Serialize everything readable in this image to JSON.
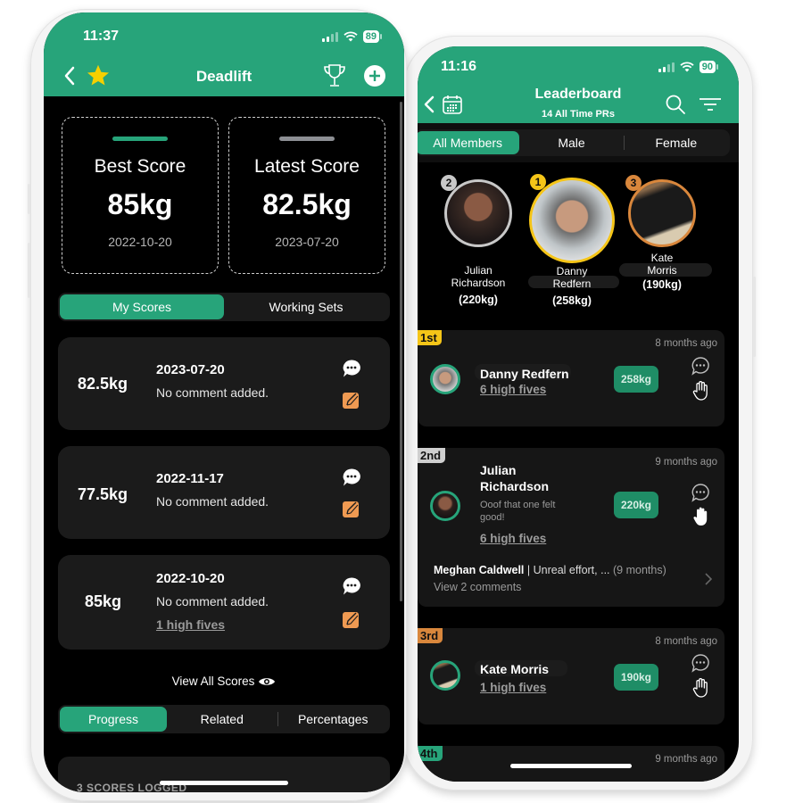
{
  "colors": {
    "brand_green": "#27a47a",
    "kg_badge_green": "#1f8d66",
    "edit_orange": "#ef9a52",
    "gold": "#f5c518",
    "silver": "#c8c8c8",
    "bronze": "#d9873c",
    "card_bg": "#1b1b1b"
  },
  "left_phone": {
    "status": {
      "time": "11:37",
      "battery": "89"
    },
    "header": {
      "title": "Deadlift",
      "icons": [
        "chevron-left-icon",
        "star-icon",
        "trophy-icon",
        "plus-circle-icon"
      ]
    },
    "best_score": {
      "label": "Best Score",
      "value": "85kg",
      "date": "2022-10-20"
    },
    "latest_score": {
      "label": "Latest Score",
      "value": "82.5kg",
      "date": "2023-07-20"
    },
    "score_tabs": [
      {
        "label": "My Scores",
        "active": true
      },
      {
        "label": "Working Sets",
        "active": false
      }
    ],
    "scores": [
      {
        "weight": "82.5kg",
        "date": "2023-07-20",
        "comment": "No comment added.",
        "high_fives": ""
      },
      {
        "weight": "77.5kg",
        "date": "2022-11-17",
        "comment": "No comment added.",
        "high_fives": ""
      },
      {
        "weight": "85kg",
        "date": "2022-10-20",
        "comment": "No comment added.",
        "high_fives": "1 high fives"
      }
    ],
    "view_all_label": "View All Scores",
    "bottom_tabs": [
      {
        "label": "Progress",
        "active": true
      },
      {
        "label": "Related",
        "active": false
      },
      {
        "label": "Percentages",
        "active": false
      }
    ],
    "scores_logged": "3 SCORES LOGGED"
  },
  "right_phone": {
    "status": {
      "time": "11:16",
      "battery": "90"
    },
    "header": {
      "title": "Leaderboard",
      "subtitle": "14 All Time PRs",
      "icons": [
        "chevron-left-icon",
        "calendar-icon",
        "search-icon",
        "filter-icon"
      ]
    },
    "filter_tabs": [
      {
        "label": "All Members",
        "active": true
      },
      {
        "label": "Male",
        "active": false
      },
      {
        "label": "Female",
        "active": false
      }
    ],
    "podium": [
      {
        "rank": "2",
        "name_line1": "Julian",
        "name_line2": "Richardson",
        "weight": "(220kg)"
      },
      {
        "rank": "1",
        "name_line1": "Danny",
        "name_line2": "Redfern",
        "weight": "(258kg)"
      },
      {
        "rank": "3",
        "name_line1": "Kate",
        "name_line2": "Morris",
        "weight": "(190kg)"
      }
    ],
    "entries": [
      {
        "rank": "1st",
        "name": "Danny Redfern",
        "time_ago": "8 months ago",
        "weight": "258kg",
        "high_fives": "6 high fives"
      },
      {
        "rank": "2nd",
        "name_line1": "Julian",
        "name_line2": "Richardson",
        "note": "Ooof that one felt good!",
        "time_ago": "9 months ago",
        "weight": "220kg",
        "high_fives": "6 high fives",
        "comment_author": "Meghan Caldwell",
        "comment_text": " | Unreal effort, ... ",
        "comment_age": "(9 months)",
        "view_comments": "View 2 comments"
      },
      {
        "rank": "3rd",
        "name": "Kate Morris",
        "time_ago": "8 months ago",
        "weight": "190kg",
        "high_fives": "1 high fives"
      },
      {
        "rank": "4th",
        "time_ago": "9 months ago"
      }
    ]
  }
}
